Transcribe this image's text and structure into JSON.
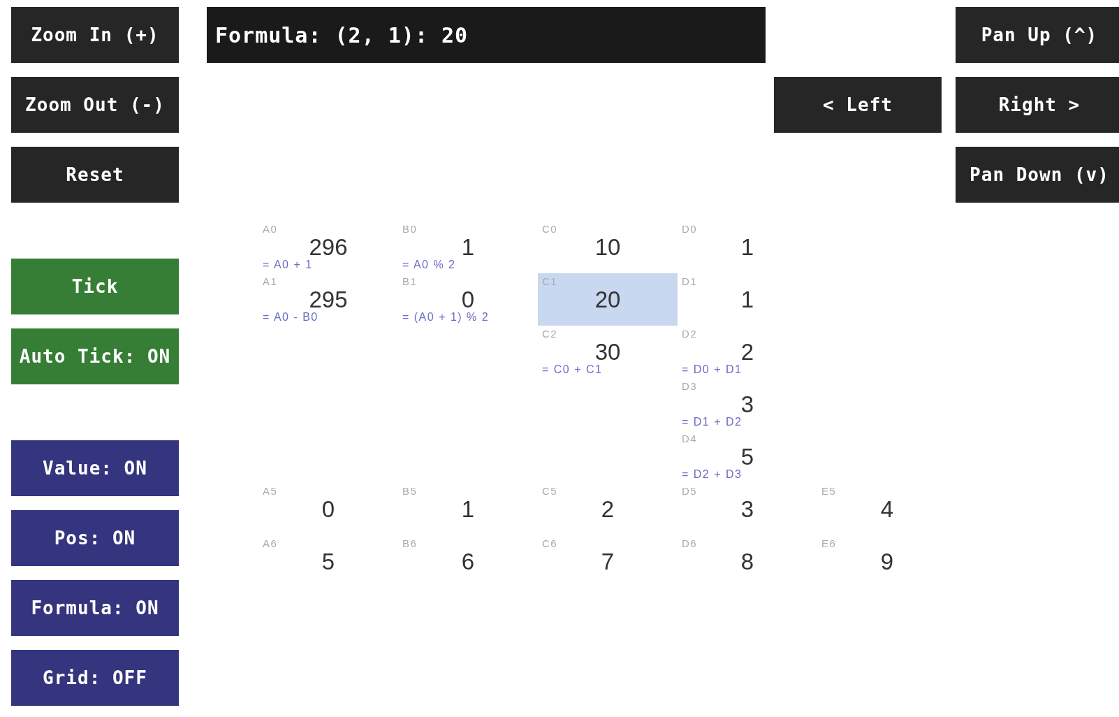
{
  "sidebar": {
    "view_buttons": [
      "Zoom In (+)",
      "Zoom Out (-)",
      "Reset"
    ],
    "simulation_buttons": [
      "Tick",
      "Auto Tick: ON"
    ],
    "display_toggles": [
      "Value: ON",
      "Pos: ON",
      "Formula: ON",
      "Grid: OFF"
    ]
  },
  "formula_bar": {
    "text": "Formula: (2, 1): 20"
  },
  "pan_controls": {
    "up": "Pan Up (^)",
    "left": "< Left",
    "right": "Right >",
    "down": "Pan Down (v)"
  },
  "grid": {
    "rows": [
      {
        "cells": [
          {
            "kind": "filled",
            "position": "A0",
            "value": "296",
            "formula": "= A0 + 1",
            "selected": false
          },
          {
            "kind": "filled",
            "position": "B0",
            "value": "1",
            "formula": "= A0 % 2",
            "selected": false
          },
          {
            "kind": "filled",
            "position": "C0",
            "value": "10",
            "selected": false
          },
          {
            "kind": "filled",
            "position": "D0",
            "value": "1",
            "selected": false
          },
          {
            "kind": "blank"
          }
        ]
      },
      {
        "cells": [
          {
            "kind": "filled",
            "position": "A1",
            "value": "295",
            "formula": "= A0 - B0",
            "selected": false
          },
          {
            "kind": "filled",
            "position": "B1",
            "value": "0",
            "formula": "= (A0 + 1) % 2",
            "selected": false
          },
          {
            "kind": "filled",
            "position": "C1",
            "value": "20",
            "selected": true
          },
          {
            "kind": "filled",
            "position": "D1",
            "value": "1",
            "selected": false
          },
          {
            "kind": "blank"
          }
        ]
      },
      {
        "cells": [
          {
            "kind": "blank"
          },
          {
            "kind": "blank"
          },
          {
            "kind": "filled",
            "position": "C2",
            "value": "30",
            "formula": "= C0 + C1",
            "selected": false
          },
          {
            "kind": "filled",
            "position": "D2",
            "value": "2",
            "formula": "= D0 + D1",
            "selected": false
          },
          {
            "kind": "blank"
          }
        ]
      },
      {
        "cells": [
          {
            "kind": "blank"
          },
          {
            "kind": "blank"
          },
          {
            "kind": "blank"
          },
          {
            "kind": "filled",
            "position": "D3",
            "value": "3",
            "formula": "= D1 + D2",
            "selected": false
          },
          {
            "kind": "blank"
          }
        ]
      },
      {
        "cells": [
          {
            "kind": "blank"
          },
          {
            "kind": "blank"
          },
          {
            "kind": "blank"
          },
          {
            "kind": "filled",
            "position": "D4",
            "value": "5",
            "formula": "= D2 + D3",
            "selected": false
          },
          {
            "kind": "blank"
          }
        ]
      },
      {
        "cells": [
          {
            "kind": "filled",
            "position": "A5",
            "value": "0",
            "selected": false
          },
          {
            "kind": "filled",
            "position": "B5",
            "value": "1",
            "selected": false
          },
          {
            "kind": "filled",
            "position": "C5",
            "value": "2",
            "selected": false
          },
          {
            "kind": "filled",
            "position": "D5",
            "value": "3",
            "selected": false
          },
          {
            "kind": "filled",
            "position": "E5",
            "value": "4",
            "selected": false
          }
        ]
      },
      {
        "cells": [
          {
            "kind": "filled",
            "position": "A6",
            "value": "5",
            "selected": false
          },
          {
            "kind": "filled",
            "position": "B6",
            "value": "6",
            "selected": false
          },
          {
            "kind": "filled",
            "position": "C6",
            "value": "7",
            "selected": false
          },
          {
            "kind": "filled",
            "position": "D6",
            "value": "8",
            "selected": false
          },
          {
            "kind": "filled",
            "position": "E6",
            "value": "9",
            "selected": false
          }
        ]
      }
    ]
  }
}
